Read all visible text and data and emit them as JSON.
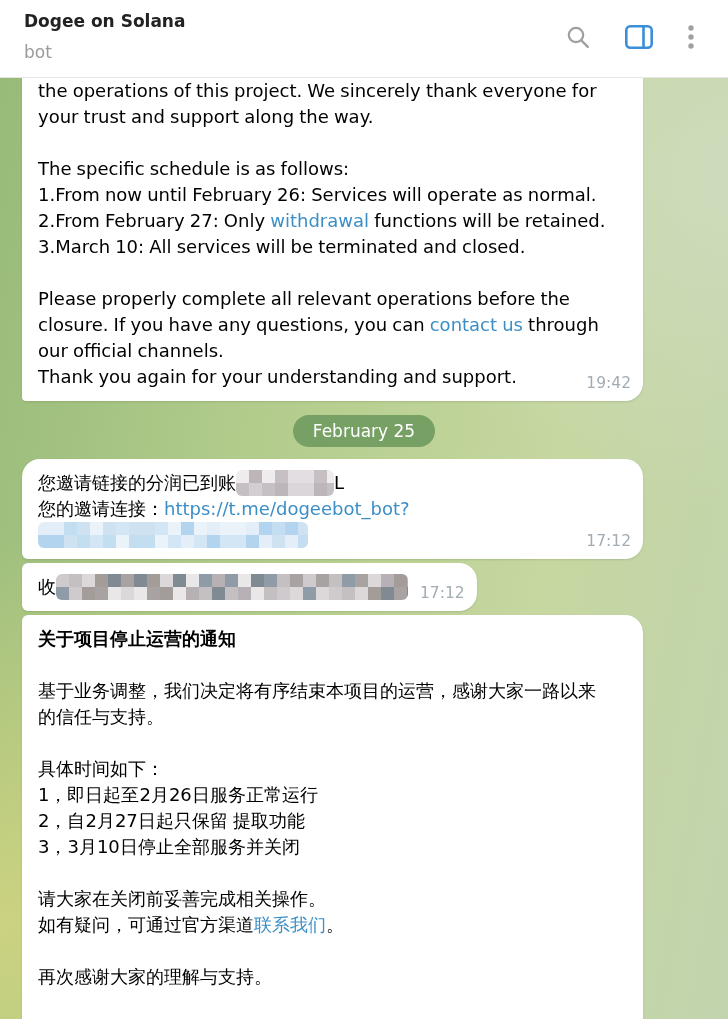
{
  "header": {
    "title": "Dogee on Solana",
    "subtitle": "bot",
    "side_panel_on": true
  },
  "chat": [
    {
      "kind": "message",
      "paragraphs": [
        {
          "lines": [
            [
              {
                "kind": "text",
                "text": "the operations of this project. We sincerely thank everyone for your trust and support along the way."
              }
            ]
          ]
        },
        {
          "lines": [
            [
              {
                "kind": "text",
                "text": "The specific schedule is as follows:"
              }
            ],
            [
              {
                "kind": "text",
                "text": "1.From now until February 26: Services will operate as normal."
              }
            ],
            [
              {
                "kind": "text",
                "text": "2.From February 27: Only "
              },
              {
                "kind": "link",
                "text": "withdrawal"
              },
              {
                "kind": "text",
                "text": " functions will be retained."
              }
            ],
            [
              {
                "kind": "text",
                "text": "3.March 10: All services will be terminated and closed."
              }
            ]
          ]
        },
        {
          "lines": [
            [
              {
                "kind": "text",
                "text": "Please properly complete all relevant operations before the closure. If you have any questions, you can "
              },
              {
                "kind": "link",
                "text": "contact us"
              },
              {
                "kind": "text",
                "text": " through our official channels."
              }
            ],
            [
              {
                "kind": "text",
                "text": "Thank you again for your understanding and support."
              }
            ]
          ]
        }
      ],
      "time": "19:42"
    },
    {
      "kind": "date",
      "text": "February 25"
    },
    {
      "kind": "message",
      "paragraphs": [
        {
          "lines": [
            [
              {
                "kind": "text",
                "text": "您邀请链接的分润已到账"
              },
              {
                "kind": "redacted"
              },
              {
                "kind": "text",
                "text": "L"
              }
            ],
            [
              {
                "kind": "text",
                "text": "您的邀请连接："
              },
              {
                "kind": "link",
                "text": "https://t.me/dogeebot_bot?"
              }
            ],
            [
              {
                "kind": "redacted"
              }
            ]
          ]
        }
      ],
      "time": "17:12"
    },
    {
      "kind": "message",
      "paragraphs": [
        {
          "lines": [
            [
              {
                "kind": "text",
                "text": "收"
              },
              {
                "kind": "redacted"
              }
            ]
          ]
        }
      ],
      "time": "17:12"
    },
    {
      "kind": "message",
      "paragraphs": [
        {
          "lines": [
            [
              {
                "kind": "bold",
                "text": "关于项目停止运营的通知"
              }
            ]
          ]
        },
        {
          "lines": [
            [
              {
                "kind": "text",
                "text": "基于业务调整，我们决定将有序结束本项目的运营，感谢大家一路以来的信任与支持。"
              }
            ]
          ]
        },
        {
          "lines": [
            [
              {
                "kind": "text",
                "text": "具体时间如下："
              }
            ],
            [
              {
                "kind": "text",
                "text": "1，即日起至2月26日服务正常运行"
              }
            ],
            [
              {
                "kind": "text",
                "text": "2，自2月27日起只保留 提取功能"
              }
            ],
            [
              {
                "kind": "text",
                "text": "3，3月10日停止全部服务并关闭"
              }
            ]
          ]
        },
        {
          "lines": [
            [
              {
                "kind": "text",
                "text": "请大家在关闭前妥善完成相关操作。"
              }
            ],
            [
              {
                "kind": "text",
                "text": "如有疑问，可通过官方渠道"
              },
              {
                "kind": "link",
                "text": "联系我们"
              },
              {
                "kind": "text",
                "text": "。"
              }
            ]
          ]
        },
        {
          "lines": [
            [
              {
                "kind": "text",
                "text": "再次感谢大家的理解与支持。"
              }
            ]
          ]
        }
      ]
    }
  ]
}
